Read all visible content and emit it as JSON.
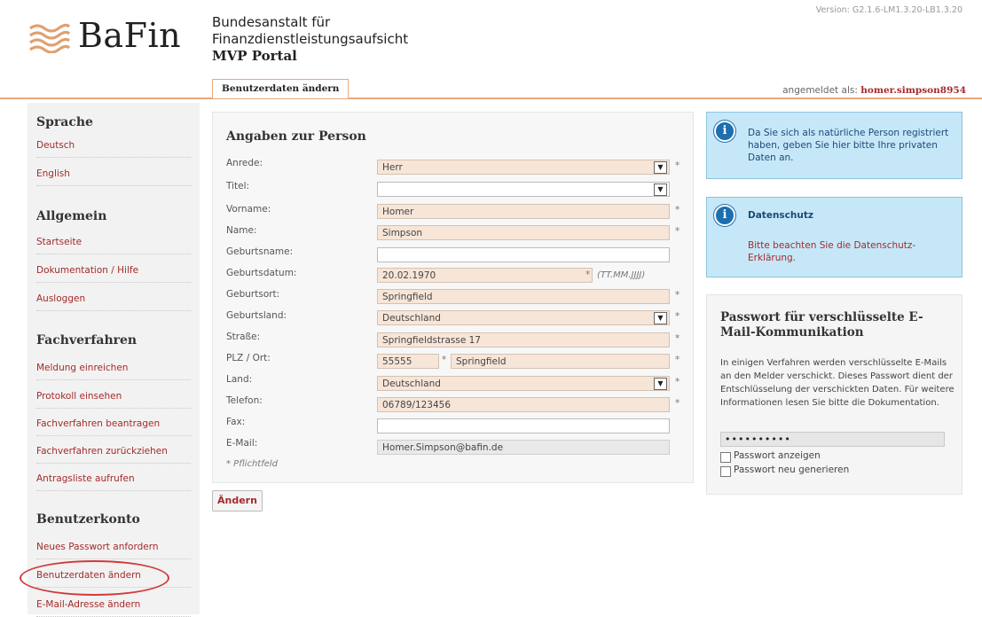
{
  "header": {
    "logo_text": "BaFin",
    "institution_line1": "Bundesanstalt für",
    "institution_line2": "Finanzdienstleistungsaufsicht",
    "portal": "MVP Portal",
    "version": "Version: G2.1.6-LM1.3.20-LB1.3.20",
    "tab": "Benutzerdaten ändern",
    "login_prefix": "angemeldet als:",
    "login_user": "homer.simpson8954"
  },
  "sidebar": {
    "sections": [
      {
        "title": "Sprache",
        "items": [
          "Deutsch",
          "English"
        ]
      },
      {
        "title": "Allgemein",
        "items": [
          "Startseite",
          "Dokumentation / Hilfe",
          "Ausloggen"
        ]
      },
      {
        "title": "Fachverfahren",
        "items": [
          "Meldung einreichen",
          "Protokoll einsehen",
          "Fachverfahren beantragen",
          "Fachverfahren zurückziehen",
          "Antragsliste aufrufen"
        ]
      },
      {
        "title": "Benutzerkonto",
        "items": [
          "Neues Passwort anfordern",
          "Benutzerdaten ändern",
          "E-Mail-Adresse ändern"
        ]
      }
    ]
  },
  "form": {
    "title": "Angaben zur Person",
    "fields": {
      "anrede": {
        "label": "Anrede:",
        "value": "Herr"
      },
      "titel": {
        "label": "Titel:",
        "value": ""
      },
      "vorname": {
        "label": "Vorname:",
        "value": "Homer"
      },
      "name": {
        "label": "Name:",
        "value": "Simpson"
      },
      "geburtsname": {
        "label": "Geburtsname:",
        "value": ""
      },
      "geburtsdatum": {
        "label": "Geburtsdatum:",
        "value": "20.02.1970",
        "hint": "(TT.MM.JJJJ)"
      },
      "geburtsort": {
        "label": "Geburtsort:",
        "value": "Springfield"
      },
      "geburtsland": {
        "label": "Geburtsland:",
        "value": "Deutschland"
      },
      "strasse": {
        "label": "Straße:",
        "value": "Springfieldstrasse 17"
      },
      "plz_ort": {
        "label": "PLZ / Ort:",
        "plz": "55555",
        "ort": "Springfield"
      },
      "land": {
        "label": "Land:",
        "value": "Deutschland"
      },
      "telefon": {
        "label": "Telefon:",
        "value": "06789/123456"
      },
      "fax": {
        "label": "Fax:",
        "value": ""
      },
      "email": {
        "label": "E-Mail:",
        "value": "Homer.Simpson@bafin.de"
      }
    },
    "required_mark": "*",
    "required_note": "* Pflichtfeld",
    "submit": "Ändern"
  },
  "info_private": "Da Sie sich als natürliche Person registriert haben, geben Sie hier bitte Ihre privaten Daten an.",
  "datenschutz": {
    "title": "Datenschutz",
    "text": "Bitte beachten Sie die Datenschutz-Erklärung."
  },
  "password": {
    "title": "Passwort für verschlüsselte E-Mail-Kommunikation",
    "text": "In einigen Verfahren werden verschlüsselte E-Mails an den Melder verschickt. Dieses Passwort dient der Entschlüsselung der verschickten Daten. Für weitere Informationen lesen Sie bitte die Dokumentation.",
    "masked_value": "••••••••••",
    "show_label": "Passwort anzeigen",
    "regenerate_label": "Passwort neu generieren"
  },
  "colors": {
    "accent": "#a52a2a",
    "field_bg": "#f7e5d8",
    "info_bg": "#c6e7f7",
    "highlight": "#d23b3b"
  },
  "icons": [
    "bafin-logo-icon",
    "info-icon",
    "chevron-down-icon"
  ]
}
